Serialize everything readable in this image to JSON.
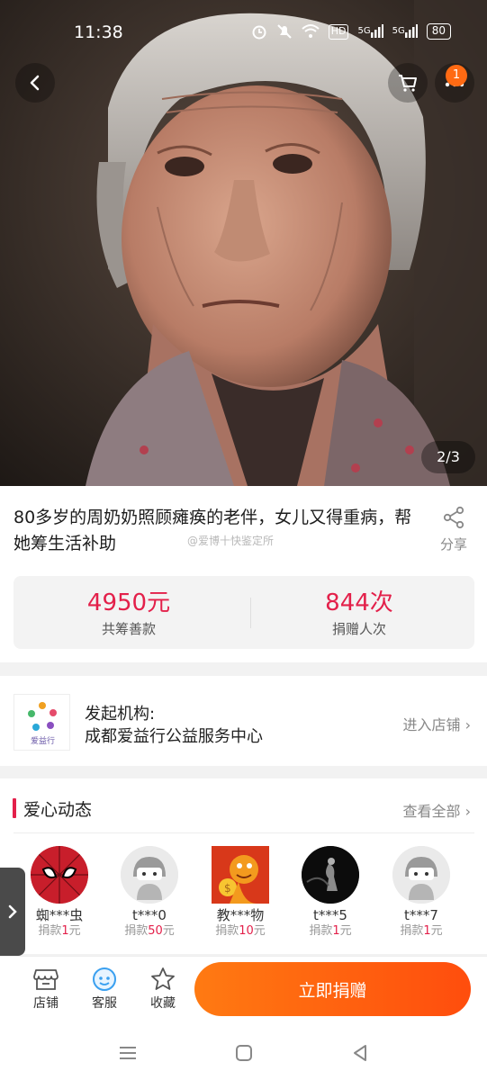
{
  "status_bar": {
    "time": "11:38",
    "network_labels": [
      "HD",
      "5G",
      "5G"
    ],
    "battery": "80"
  },
  "header": {
    "cart_badge_count": "1",
    "image_counter": "2/3"
  },
  "project": {
    "title": "80多岁的周奶奶照顾瘫痪的老伴，女儿又得重病，帮她筹生活补助",
    "watermark": "@爱博十快鉴定所",
    "share_label": "分享",
    "raised_value": "4950元",
    "raised_label": "共筹善款",
    "donors_value": "844次",
    "donors_label": "捐赠人次"
  },
  "organizer": {
    "label": "发起机构:",
    "name": "成都爱益行公益服务中心",
    "logo_text": "爱益行",
    "link_label": "进入店铺"
  },
  "feed": {
    "title": "爱心动态",
    "more_label": "查看全部",
    "donors": [
      {
        "name": "蜘***虫",
        "amount_prefix": "捐款",
        "amount": "1",
        "unit": "元",
        "avatar": "spiderman-avatar"
      },
      {
        "name": "t***0",
        "amount_prefix": "捐款",
        "amount": "50",
        "unit": "元",
        "avatar": "default-avatar"
      },
      {
        "name": "教***物",
        "amount_prefix": "捐款",
        "amount": "10",
        "unit": "元",
        "avatar": "cartoon-avatar"
      },
      {
        "name": "t***5",
        "amount_prefix": "捐款",
        "amount": "1",
        "unit": "元",
        "avatar": "dark-photo-avatar"
      },
      {
        "name": "t***7",
        "amount_prefix": "捐款",
        "amount": "1",
        "unit": "元",
        "avatar": "default-avatar"
      }
    ]
  },
  "actions": {
    "shop_label": "店铺",
    "service_label": "客服",
    "favorite_label": "收藏",
    "donate_label": "立即捐赠"
  },
  "colors": {
    "accent_red": "#e3204a",
    "donate_orange": "#ff6a13",
    "badge_orange": "#ff6a13"
  }
}
